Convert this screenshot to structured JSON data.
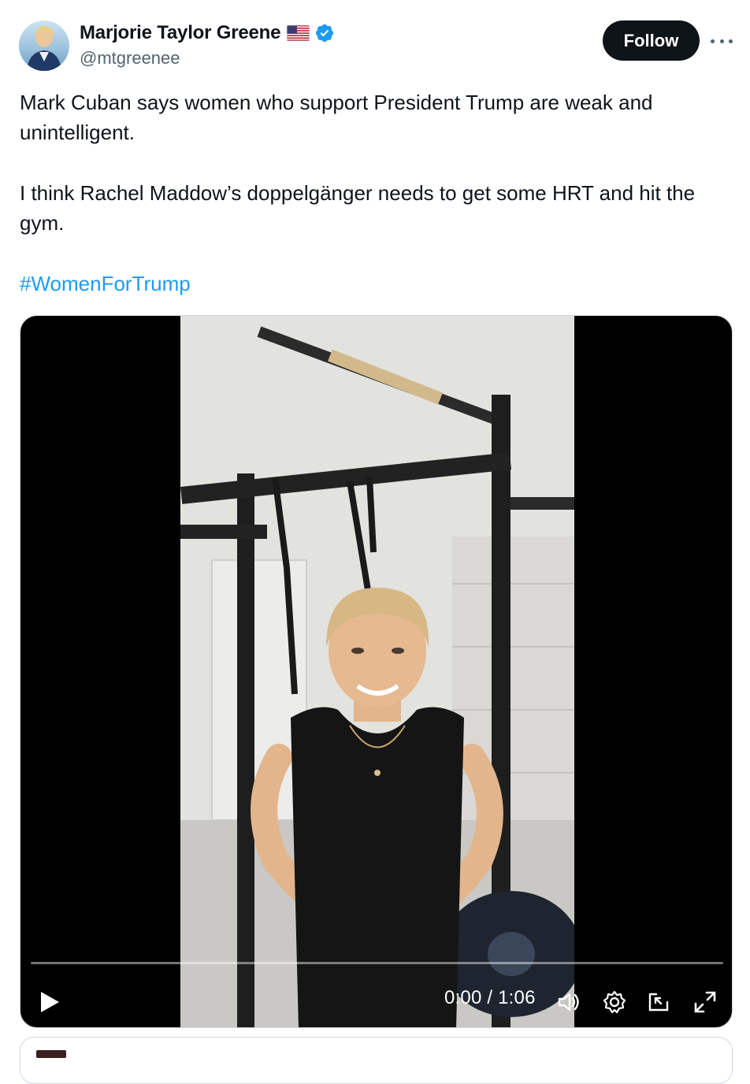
{
  "author": {
    "name": "Marjorie Taylor Greene",
    "handle": "@mtgreenee",
    "flag_icon": "us-flag-icon",
    "verified_icon": "verified-badge-icon"
  },
  "actions": {
    "follow_label": "Follow",
    "more_icon": "more-horizontal-icon"
  },
  "tweet": {
    "paragraphs": [
      "Mark Cuban says women who support President Trump are weak and unintelligent.",
      "I think Rachel Maddow’s doppelgänger needs to get some HRT and hit the gym."
    ],
    "hashtag": "#WomenForTrump"
  },
  "video": {
    "current_time": "0:00",
    "separator": " / ",
    "duration": "1:06",
    "progress_fraction": 0.0,
    "controls": [
      "play-icon",
      "volume-icon",
      "settings-icon",
      "picture-in-picture-icon",
      "fullscreen-icon"
    ]
  },
  "colors": {
    "text": "#0f1419",
    "secondary_text": "#536471",
    "link": "#1d9bf0",
    "verified": "#1d9bf0",
    "follow_bg": "#0f1419"
  }
}
